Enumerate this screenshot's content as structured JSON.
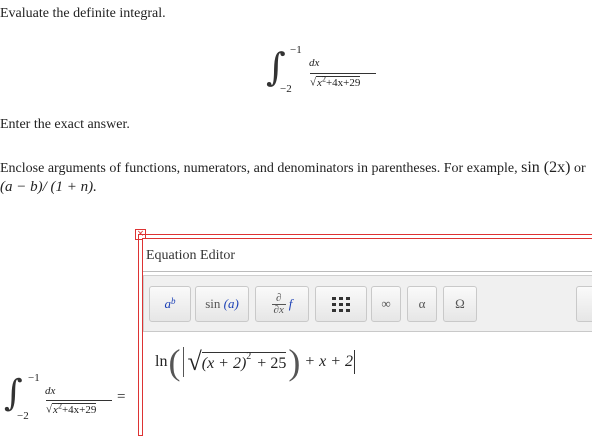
{
  "problem": {
    "prompt": "Evaluate the definite integral.",
    "integral": {
      "lower": "−2",
      "upper": "−1",
      "numerator": "dx",
      "radicand_x": "x",
      "radicand_exp": "2",
      "radicand_rest": "+4x+29"
    },
    "instruction": "Enter the exact answer.",
    "hint_text": "Enclose arguments of functions, numerators, and denominators in parentheses. For example,",
    "hint_example1": "sin (2x)",
    "hint_or": "or",
    "hint_example2": "(a − b)/ (1 + n)."
  },
  "editor": {
    "title": "Equation Editor",
    "close_glyph": "×",
    "toolbar": {
      "power_base": "a",
      "power_exp": "b",
      "sin_label": "sin",
      "sin_arg": "(a)",
      "deriv_num": "∂",
      "deriv_den": "∂x",
      "deriv_f": "f",
      "infinity": "∞",
      "alpha": "α",
      "omega": "Ω",
      "more": "⫿"
    },
    "entry": {
      "ln": "ln",
      "inner": "(x + 2)",
      "exp": "2",
      "plus25": "+ 25",
      "tail": "+ x + 2"
    }
  },
  "answer_lhs": {
    "lower": "−2",
    "upper": "−1",
    "numerator": "dx",
    "radicand_x": "x",
    "radicand_exp": "2",
    "radicand_rest": "+4x+29",
    "equals": "="
  }
}
